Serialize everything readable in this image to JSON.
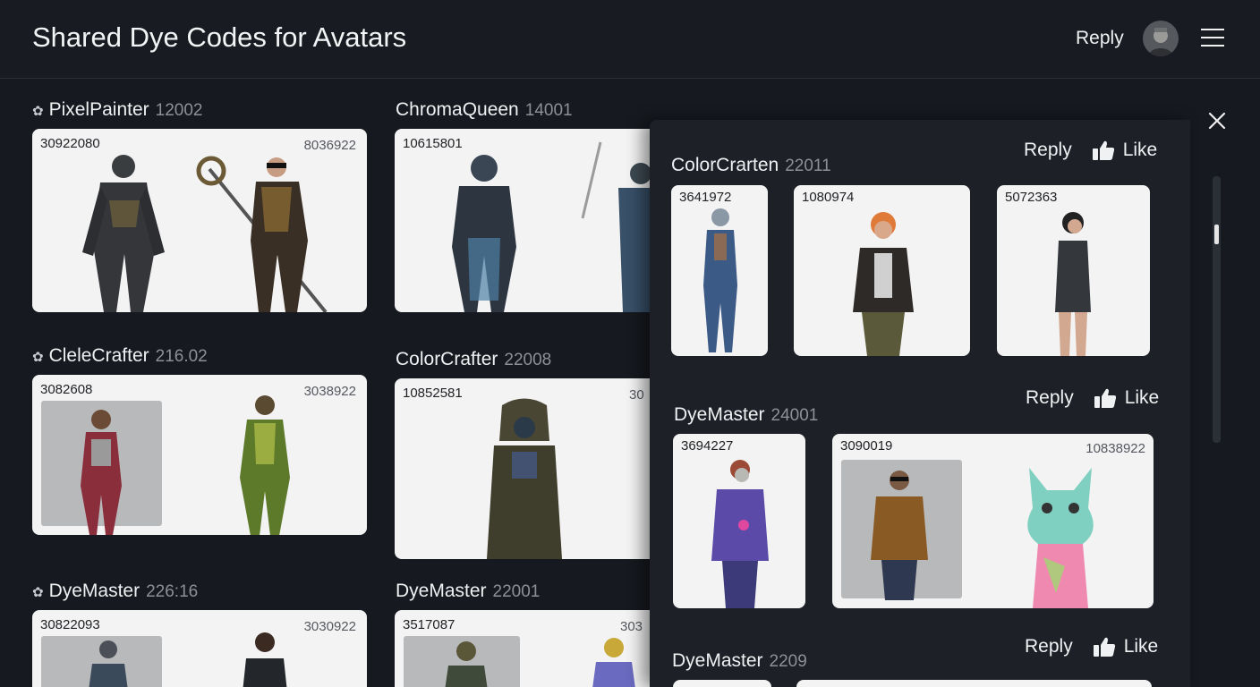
{
  "header": {
    "title": "Shared Dye Codes for Avatars",
    "reply_label": "Reply"
  },
  "gallery": [
    {
      "name": "PixelPainter",
      "count": "12002",
      "code_left": "30922080",
      "code_right": "8036922"
    },
    {
      "name": "ChromaQueen",
      "count": "14001",
      "code_left": "10615801",
      "code_right": ""
    },
    {
      "name": "CleleCrafter",
      "count": "216.02",
      "code_left": "3082608",
      "code_right": "3038922"
    },
    {
      "name": "ColorCrafter",
      "count": "22008",
      "code_left": "10852581",
      "code_right": "30"
    },
    {
      "name": "DyeMaster",
      "count": "226:16",
      "code_left": "30822093",
      "code_right": "3030922"
    },
    {
      "name": "DyeMaster",
      "count": "22001",
      "code_left": "3517087",
      "code_right": "303"
    }
  ],
  "panel": {
    "reply_label": "Reply",
    "like_label": "Like",
    "comments": [
      {
        "name": "ColorCrarten",
        "count": "22011",
        "codes": [
          "3641972",
          "1080974",
          "5072363"
        ]
      },
      {
        "name": "DyeMaster",
        "count": "24001",
        "codes": [
          "3694227",
          "3090019",
          "10838922"
        ]
      },
      {
        "name": "DyeMaster",
        "count": "2209"
      }
    ]
  },
  "icons": [
    "user-icon",
    "thumbs-up-icon",
    "close-icon",
    "menu-icon"
  ],
  "colors": {
    "background": "#16191f",
    "panel": "#1d2027",
    "card": "#f3f3f3",
    "muted": "#8d9197"
  }
}
